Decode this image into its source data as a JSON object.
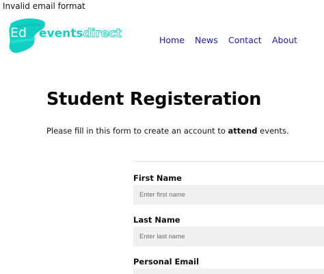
{
  "error": {
    "message": "Invalid email format"
  },
  "logo": {
    "letters": "Ed",
    "name_part1": "events",
    "name_part2": "direct",
    "brush_color": "#12cfc4",
    "text_color": "#ffffff",
    "accent_color": "#1fd6cc"
  },
  "nav": {
    "items": [
      {
        "label": "Home"
      },
      {
        "label": "News"
      },
      {
        "label": "Contact"
      },
      {
        "label": "About"
      }
    ],
    "color": "#1a1aa8"
  },
  "main": {
    "title": "Student Registeration",
    "intro_before": "Please fill in this form to create an account to ",
    "intro_bold": "attend",
    "intro_after": " events."
  },
  "form": {
    "first_name": {
      "label": "First Name",
      "placeholder": "Enter first name",
      "value": ""
    },
    "last_name": {
      "label": "Last Name",
      "placeholder": "Enter last name",
      "value": ""
    },
    "email": {
      "label": "Personal Email",
      "placeholder": "",
      "value": ""
    }
  }
}
